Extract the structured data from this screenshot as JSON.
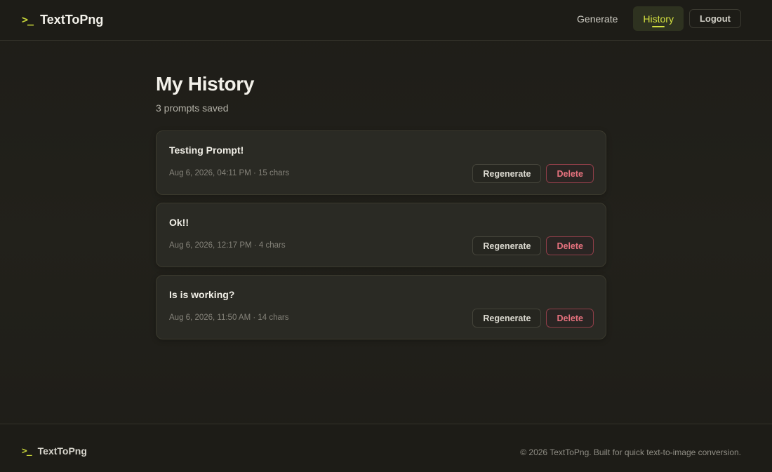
{
  "header": {
    "brand_icon": ">_",
    "brand_name": "TextToPng",
    "nav": {
      "generate": "Generate",
      "history": "History",
      "logout": "Logout"
    }
  },
  "main": {
    "title": "My History",
    "subtitle": "3 prompts saved",
    "items": [
      {
        "title": "Testing Prompt!",
        "meta": "Aug 6, 2026, 04:11 PM · 15 chars",
        "regenerate": "Regenerate",
        "delete": "Delete"
      },
      {
        "title": "Ok!!",
        "meta": "Aug 6, 2026, 12:17 PM · 4 chars",
        "regenerate": "Regenerate",
        "delete": "Delete"
      },
      {
        "title": "Is is working?",
        "meta": "Aug 6, 2026, 11:50 AM · 14 chars",
        "regenerate": "Regenerate",
        "delete": "Delete"
      }
    ]
  },
  "footer": {
    "brand_icon": ">_",
    "brand_name": "TextToPng",
    "copyright": "© 2026 TextToPng. Built for quick text-to-image conversion."
  },
  "colors": {
    "accent": "#d3e040",
    "danger": "#e7727e",
    "background": "#1f1e19",
    "card": "#2a2a24"
  }
}
